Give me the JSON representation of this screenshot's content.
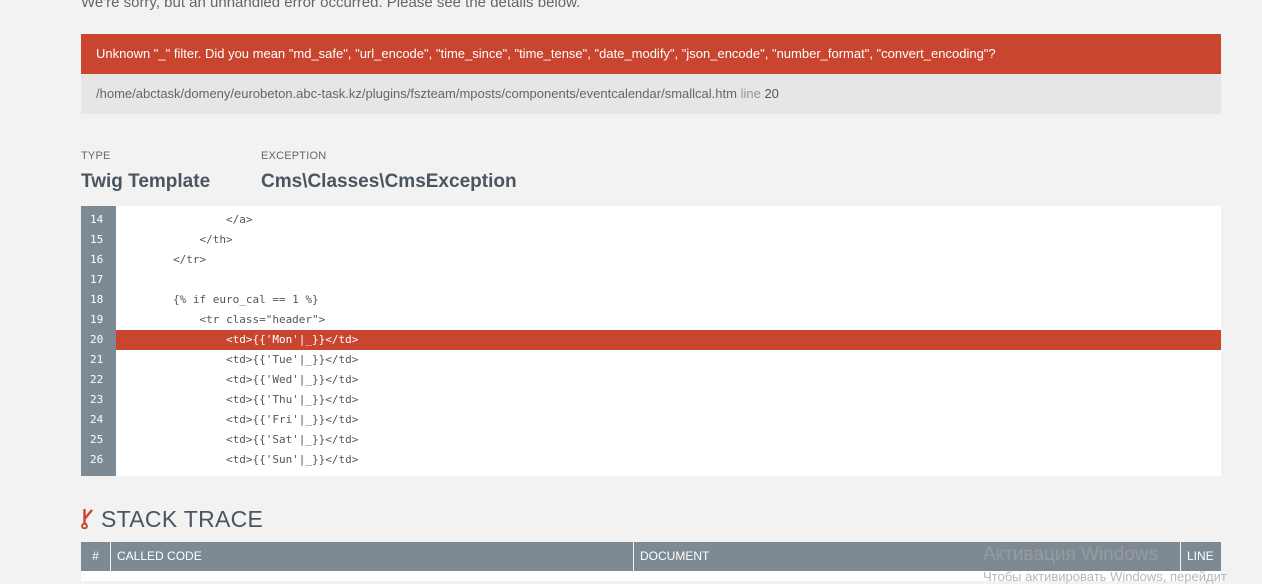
{
  "intro": "We're sorry, but an unhandled error occurred. Please see the details below.",
  "error": {
    "message": "Unknown \"_\" filter. Did you mean \"md_safe\", \"url_encode\", \"time_since\", \"time_tense\", \"date_modify\", \"json_encode\", \"number_format\", \"convert_encoding\"?",
    "path": "/home/abctask/domeny/eurobeton.abc-task.kz/plugins/fszteam/mposts/components/eventcalendar/smallcal.htm",
    "line_label": "line",
    "line_number": "20"
  },
  "meta": {
    "type_label": "TYPE",
    "type_value": "Twig Template",
    "exception_label": "EXCEPTION",
    "exception_value": "Cms\\Classes\\CmsException"
  },
  "code": {
    "highlight_line": "20",
    "lines": [
      {
        "num": "14",
        "text": "                </a>"
      },
      {
        "num": "15",
        "text": "            </th>"
      },
      {
        "num": "16",
        "text": "        </tr>"
      },
      {
        "num": "17",
        "text": ""
      },
      {
        "num": "18",
        "text": "        {% if euro_cal == 1 %}"
      },
      {
        "num": "19",
        "text": "            <tr class=\"header\">"
      },
      {
        "num": "20",
        "text": "                <td>{{'Mon'|_}}</td>"
      },
      {
        "num": "21",
        "text": "                <td>{{'Tue'|_}}</td>"
      },
      {
        "num": "22",
        "text": "                <td>{{'Wed'|_}}</td>"
      },
      {
        "num": "23",
        "text": "                <td>{{'Thu'|_}}</td>"
      },
      {
        "num": "24",
        "text": "                <td>{{'Fri'|_}}</td>"
      },
      {
        "num": "25",
        "text": "                <td>{{'Sat'|_}}</td>"
      },
      {
        "num": "26",
        "text": "                <td>{{'Sun'|_}}</td>"
      }
    ]
  },
  "stack_trace": {
    "title": "STACK TRACE",
    "icon": "branch-icon",
    "columns": [
      "#",
      "CALLED CODE",
      "DOCUMENT",
      "LINE"
    ]
  },
  "watermark": {
    "title": "Активация Windows",
    "subtitle": "Чтобы активировать Windows, перейдит"
  },
  "colors": {
    "accent": "#c9452f",
    "gutter": "#7d8a94",
    "background": "#f2f2f2"
  }
}
